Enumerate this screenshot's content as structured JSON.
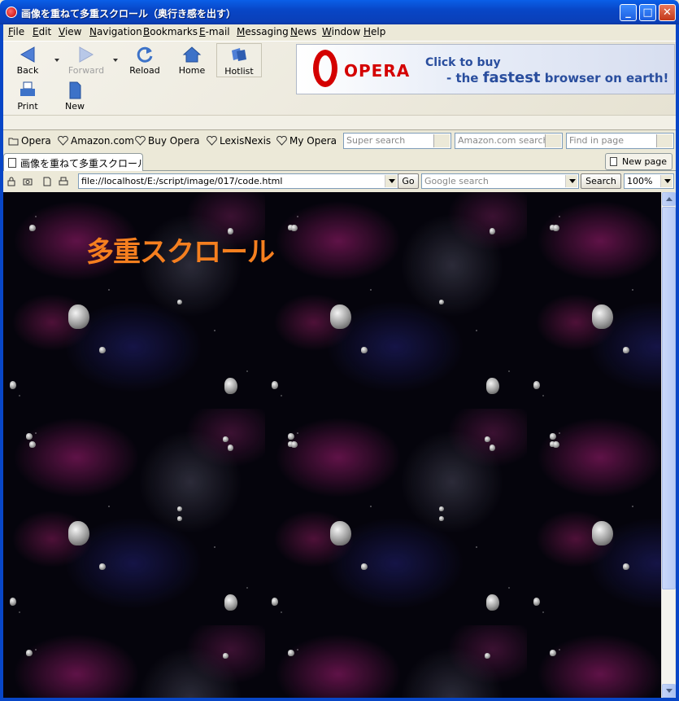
{
  "window": {
    "title": "画像を重ねて多重スクロール（奥行き感を出す）",
    "buttons": {
      "minimize": "_",
      "maximize": "□",
      "close": "✕"
    }
  },
  "menu": {
    "file": "File",
    "edit": "Edit",
    "view": "View",
    "navigation": "Navigation",
    "bookmarks": "Bookmarks",
    "email": "E-mail",
    "messaging": "Messaging",
    "news": "News",
    "window": "Window",
    "help": "Help"
  },
  "toolbar": {
    "back": "Back",
    "forward": "Forward",
    "reload": "Reload",
    "home": "Home",
    "hotlist": "Hotlist",
    "print": "Print",
    "new": "New"
  },
  "banner": {
    "brand": "OPERA",
    "slogan_line1": "Click to buy",
    "slogan_line2_prefix": "- the ",
    "slogan_line2_bold": "fastest",
    "slogan_line2_suffix": " browser on earth!"
  },
  "personal_bar": {
    "items": [
      "Opera",
      "Amazon.com",
      "Buy Opera",
      "LexisNexis",
      "My Opera"
    ],
    "super_search_placeholder": "Super search",
    "amazon_search_placeholder": "Amazon.com search",
    "find_in_page_placeholder": "Find in page"
  },
  "tabs": {
    "active_label": "画像を重ねて多重スクロール(...",
    "new_page": "New page"
  },
  "address_bar": {
    "url": "file://localhost/E:/script/image/017/code.html",
    "go": "Go",
    "google_placeholder": "Google search",
    "search": "Search",
    "zoom": "100%"
  },
  "content": {
    "heading": "多重スクロール"
  },
  "colors": {
    "title_bar": "#0a4fd6",
    "heading": "#f57f1f",
    "banner_brand": "#d40000",
    "banner_text": "#2a4e9e"
  }
}
